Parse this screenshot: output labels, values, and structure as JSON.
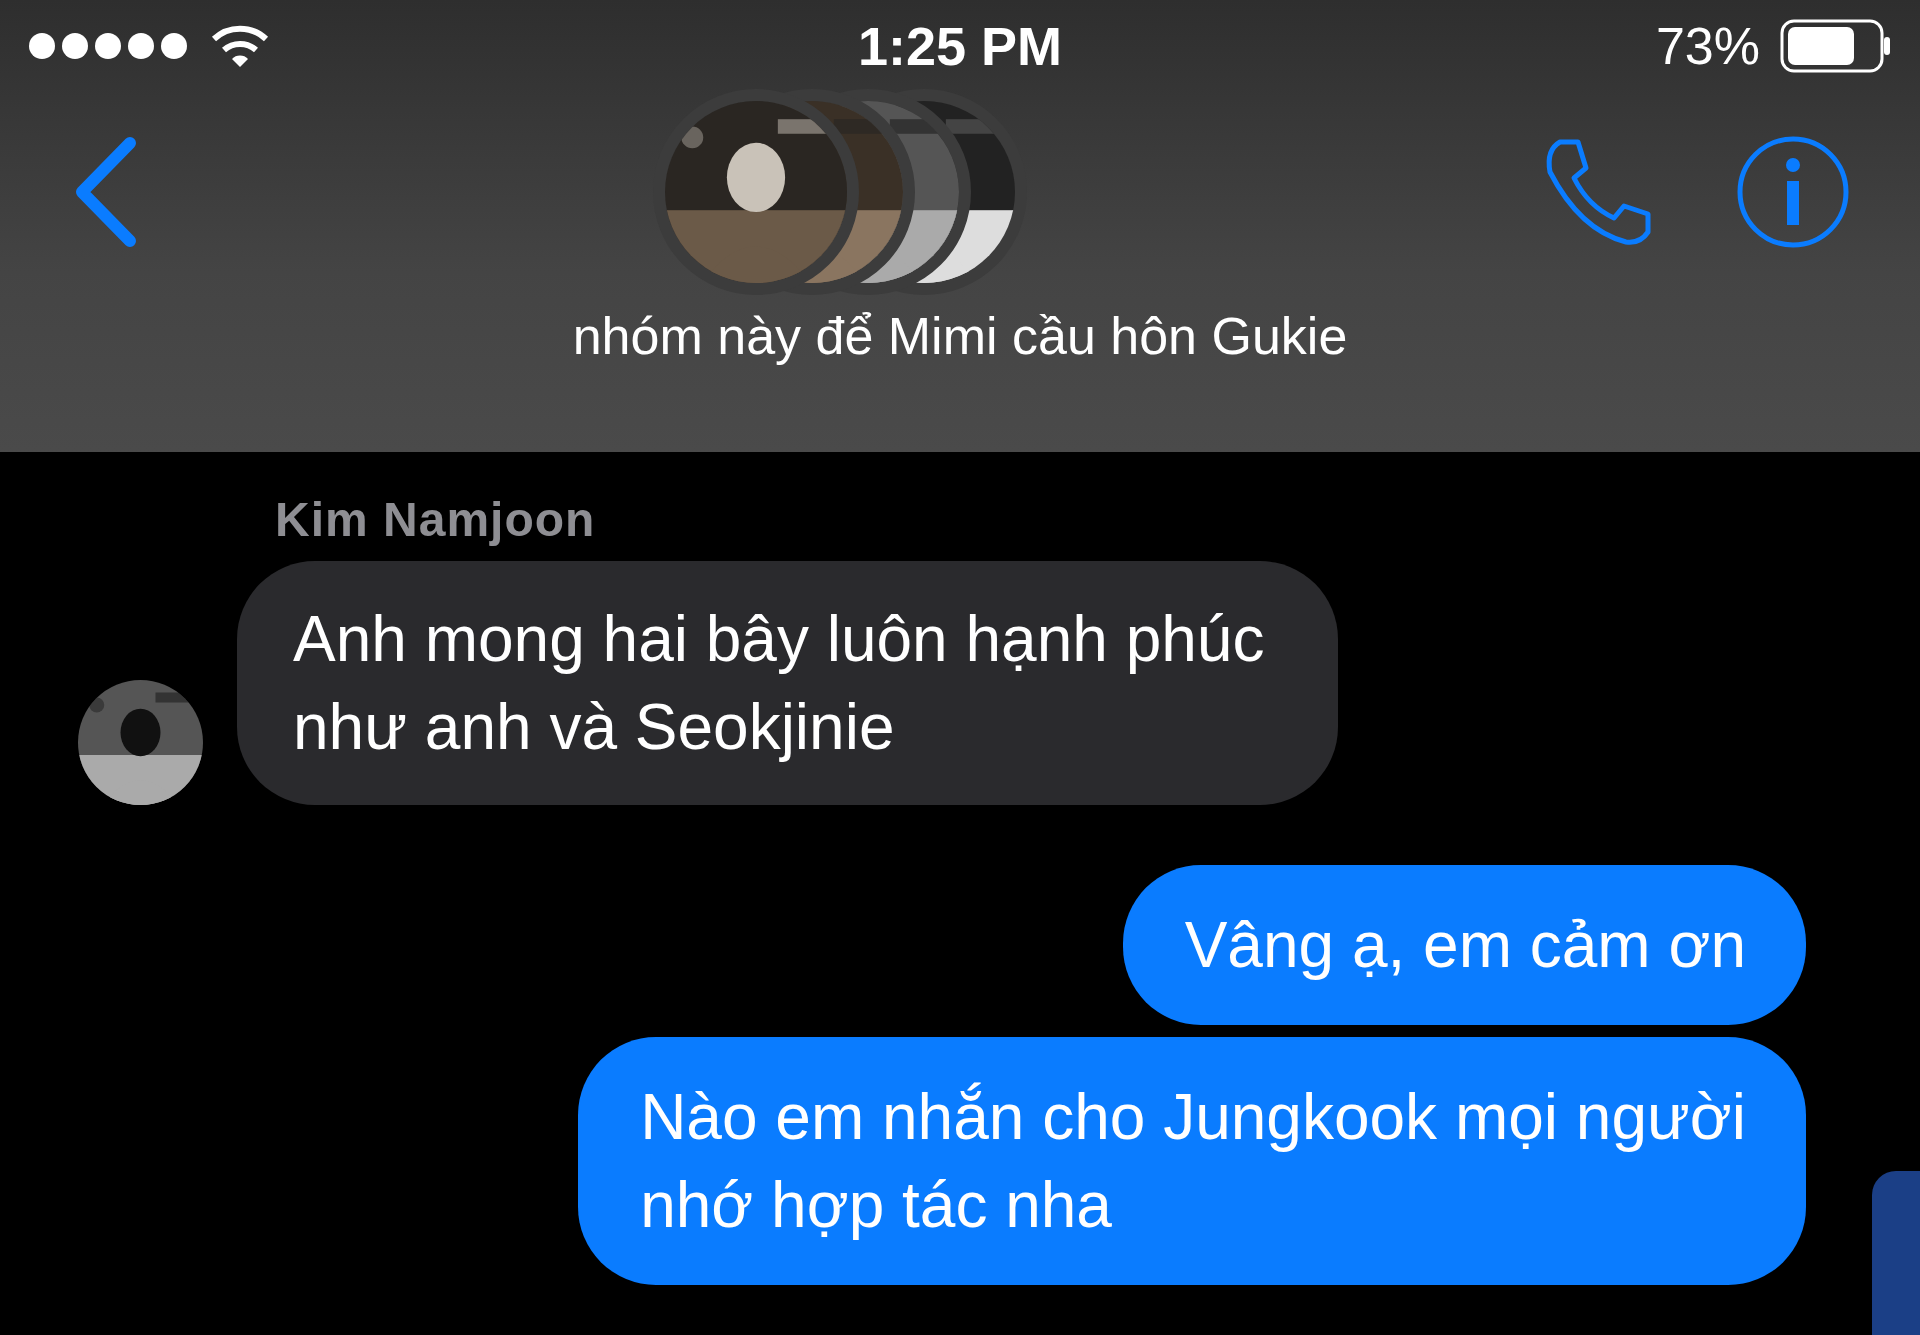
{
  "status_bar": {
    "time": "1:25 PM",
    "battery": "73%"
  },
  "header": {
    "avatars": [
      {
        "kind": "picture"
      },
      {
        "kind": "picture"
      },
      {
        "kind": "picture"
      },
      {
        "kind": "picture"
      }
    ],
    "title": "nhóm này để Mimi cầu hôn Gukie"
  },
  "messages": [
    {
      "kind": "incoming",
      "sender": "Kim Namjoon",
      "lines": [
        "Anh mong hai bây luôn hạnh phúc",
        "như anh và Seokjinie"
      ],
      "avatar": {
        "kind": "picture"
      }
    },
    {
      "kind": "outgoing",
      "lines": [
        "Vâng ạ, em cảm ơn"
      ]
    },
    {
      "kind": "outgoing",
      "lines": [
        "Nào em nhắn cho Jungkook mọi người",
        "nhớ hợp tác nha"
      ]
    }
  ]
}
